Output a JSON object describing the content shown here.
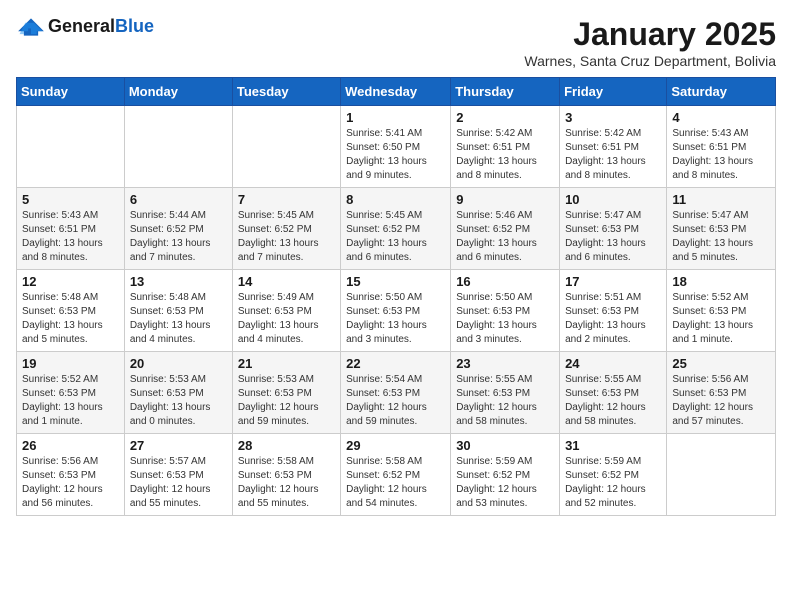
{
  "logo": {
    "general": "General",
    "blue": "Blue"
  },
  "title": "January 2025",
  "subtitle": "Warnes, Santa Cruz Department, Bolivia",
  "days_of_week": [
    "Sunday",
    "Monday",
    "Tuesday",
    "Wednesday",
    "Thursday",
    "Friday",
    "Saturday"
  ],
  "weeks": [
    [
      {
        "day": "",
        "info": ""
      },
      {
        "day": "",
        "info": ""
      },
      {
        "day": "",
        "info": ""
      },
      {
        "day": "1",
        "info": "Sunrise: 5:41 AM\nSunset: 6:50 PM\nDaylight: 13 hours and 9 minutes."
      },
      {
        "day": "2",
        "info": "Sunrise: 5:42 AM\nSunset: 6:51 PM\nDaylight: 13 hours and 8 minutes."
      },
      {
        "day": "3",
        "info": "Sunrise: 5:42 AM\nSunset: 6:51 PM\nDaylight: 13 hours and 8 minutes."
      },
      {
        "day": "4",
        "info": "Sunrise: 5:43 AM\nSunset: 6:51 PM\nDaylight: 13 hours and 8 minutes."
      }
    ],
    [
      {
        "day": "5",
        "info": "Sunrise: 5:43 AM\nSunset: 6:51 PM\nDaylight: 13 hours and 8 minutes."
      },
      {
        "day": "6",
        "info": "Sunrise: 5:44 AM\nSunset: 6:52 PM\nDaylight: 13 hours and 7 minutes."
      },
      {
        "day": "7",
        "info": "Sunrise: 5:45 AM\nSunset: 6:52 PM\nDaylight: 13 hours and 7 minutes."
      },
      {
        "day": "8",
        "info": "Sunrise: 5:45 AM\nSunset: 6:52 PM\nDaylight: 13 hours and 6 minutes."
      },
      {
        "day": "9",
        "info": "Sunrise: 5:46 AM\nSunset: 6:52 PM\nDaylight: 13 hours and 6 minutes."
      },
      {
        "day": "10",
        "info": "Sunrise: 5:47 AM\nSunset: 6:53 PM\nDaylight: 13 hours and 6 minutes."
      },
      {
        "day": "11",
        "info": "Sunrise: 5:47 AM\nSunset: 6:53 PM\nDaylight: 13 hours and 5 minutes."
      }
    ],
    [
      {
        "day": "12",
        "info": "Sunrise: 5:48 AM\nSunset: 6:53 PM\nDaylight: 13 hours and 5 minutes."
      },
      {
        "day": "13",
        "info": "Sunrise: 5:48 AM\nSunset: 6:53 PM\nDaylight: 13 hours and 4 minutes."
      },
      {
        "day": "14",
        "info": "Sunrise: 5:49 AM\nSunset: 6:53 PM\nDaylight: 13 hours and 4 minutes."
      },
      {
        "day": "15",
        "info": "Sunrise: 5:50 AM\nSunset: 6:53 PM\nDaylight: 13 hours and 3 minutes."
      },
      {
        "day": "16",
        "info": "Sunrise: 5:50 AM\nSunset: 6:53 PM\nDaylight: 13 hours and 3 minutes."
      },
      {
        "day": "17",
        "info": "Sunrise: 5:51 AM\nSunset: 6:53 PM\nDaylight: 13 hours and 2 minutes."
      },
      {
        "day": "18",
        "info": "Sunrise: 5:52 AM\nSunset: 6:53 PM\nDaylight: 13 hours and 1 minute."
      }
    ],
    [
      {
        "day": "19",
        "info": "Sunrise: 5:52 AM\nSunset: 6:53 PM\nDaylight: 13 hours and 1 minute."
      },
      {
        "day": "20",
        "info": "Sunrise: 5:53 AM\nSunset: 6:53 PM\nDaylight: 13 hours and 0 minutes."
      },
      {
        "day": "21",
        "info": "Sunrise: 5:53 AM\nSunset: 6:53 PM\nDaylight: 12 hours and 59 minutes."
      },
      {
        "day": "22",
        "info": "Sunrise: 5:54 AM\nSunset: 6:53 PM\nDaylight: 12 hours and 59 minutes."
      },
      {
        "day": "23",
        "info": "Sunrise: 5:55 AM\nSunset: 6:53 PM\nDaylight: 12 hours and 58 minutes."
      },
      {
        "day": "24",
        "info": "Sunrise: 5:55 AM\nSunset: 6:53 PM\nDaylight: 12 hours and 58 minutes."
      },
      {
        "day": "25",
        "info": "Sunrise: 5:56 AM\nSunset: 6:53 PM\nDaylight: 12 hours and 57 minutes."
      }
    ],
    [
      {
        "day": "26",
        "info": "Sunrise: 5:56 AM\nSunset: 6:53 PM\nDaylight: 12 hours and 56 minutes."
      },
      {
        "day": "27",
        "info": "Sunrise: 5:57 AM\nSunset: 6:53 PM\nDaylight: 12 hours and 55 minutes."
      },
      {
        "day": "28",
        "info": "Sunrise: 5:58 AM\nSunset: 6:53 PM\nDaylight: 12 hours and 55 minutes."
      },
      {
        "day": "29",
        "info": "Sunrise: 5:58 AM\nSunset: 6:52 PM\nDaylight: 12 hours and 54 minutes."
      },
      {
        "day": "30",
        "info": "Sunrise: 5:59 AM\nSunset: 6:52 PM\nDaylight: 12 hours and 53 minutes."
      },
      {
        "day": "31",
        "info": "Sunrise: 5:59 AM\nSunset: 6:52 PM\nDaylight: 12 hours and 52 minutes."
      },
      {
        "day": "",
        "info": ""
      }
    ]
  ]
}
